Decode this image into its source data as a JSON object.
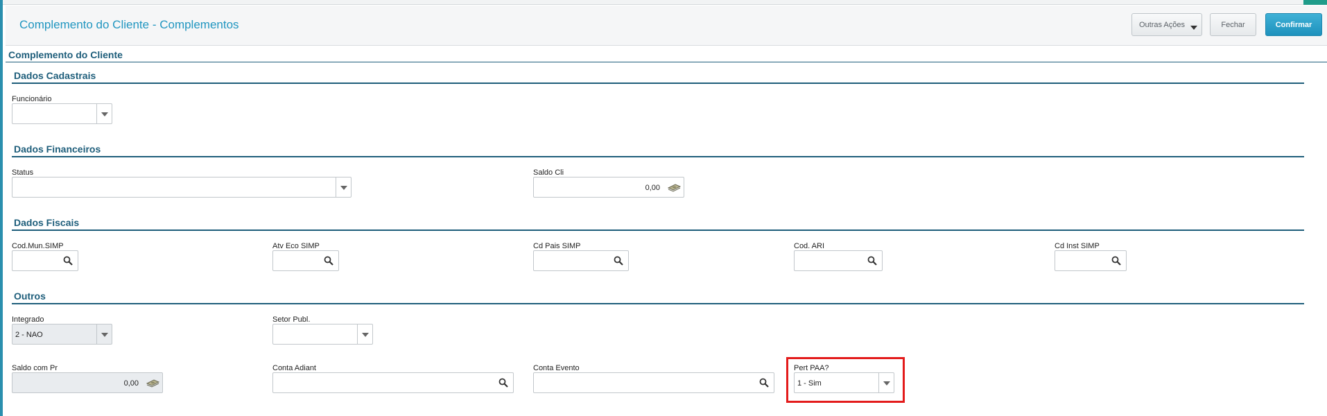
{
  "header": {
    "title": "Complemento do Cliente - Complementos",
    "buttons": {
      "outras_acoes": "Outras Ações",
      "fechar": "Fechar",
      "confirmar": "Confirmar"
    }
  },
  "form": {
    "title": "Complemento do Cliente",
    "sections": {
      "cadastrais": {
        "title": "Dados Cadastrais",
        "funcionario": {
          "label": "Funcionário",
          "value": ""
        }
      },
      "financeiros": {
        "title": "Dados Financeiros",
        "status": {
          "label": "Status",
          "value": ""
        },
        "saldo_cli": {
          "label": "Saldo Cli",
          "value": "0,00"
        }
      },
      "fiscais": {
        "title": "Dados Fiscais",
        "cod_mun_simp": {
          "label": "Cod.Mun.SIMP",
          "value": ""
        },
        "atv_eco_simp": {
          "label": "Atv Eco SIMP",
          "value": ""
        },
        "cd_pais_simp": {
          "label": "Cd Pais SIMP",
          "value": ""
        },
        "cod_ari": {
          "label": "Cod. ARI",
          "value": ""
        },
        "cd_inst_simp": {
          "label": "Cd Inst SIMP",
          "value": ""
        }
      },
      "outros": {
        "title": "Outros",
        "integrado": {
          "label": "Integrado",
          "value": "2 - NAO"
        },
        "setor_publ": {
          "label": "Setor Publ.",
          "value": ""
        },
        "saldo_com_pr": {
          "label": "Saldo com Pr",
          "value": "0,00"
        },
        "conta_adiant": {
          "label": "Conta Adiant",
          "value": ""
        },
        "conta_evento": {
          "label": "Conta Evento",
          "value": ""
        },
        "pert_paa": {
          "label": "Pert PAA?",
          "value": "1 - Sim"
        }
      }
    }
  },
  "icons": {
    "search": "magnifier-icon",
    "money": "money-icon",
    "dropdown": "chevron-down-icon"
  },
  "colors": {
    "accent": "#2196c0",
    "section": "#1d5d7a",
    "confirm": "#1e92bd",
    "highlight": "#e31b1b"
  }
}
